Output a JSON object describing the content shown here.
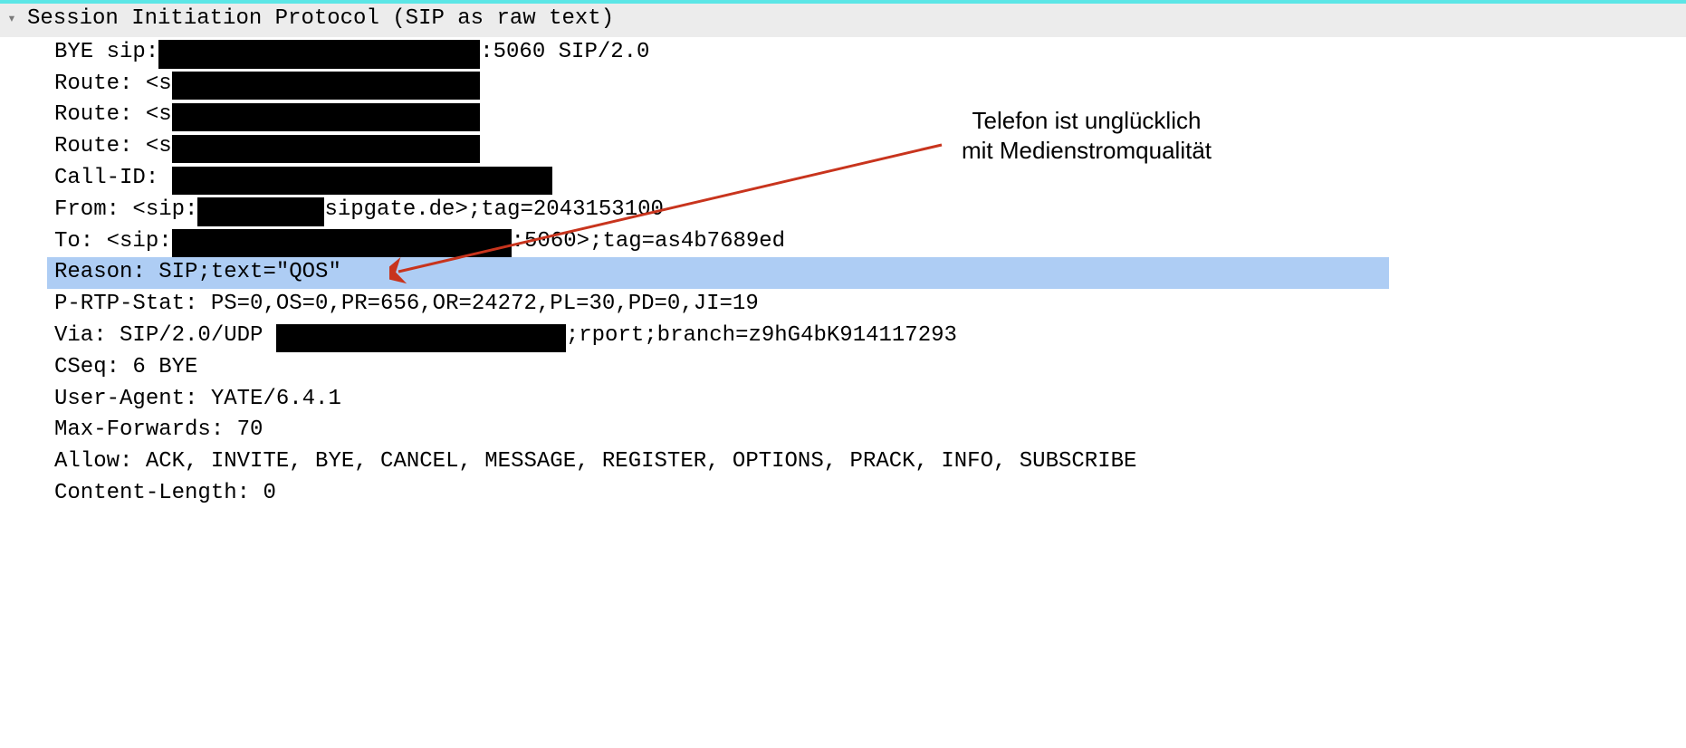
{
  "header": {
    "title": "Session Initiation Protocol (SIP as raw text)"
  },
  "sip": {
    "bye_before": "BYE sip:",
    "bye_after": ":5060 SIP/2.0",
    "route_prefix": "Route: <s",
    "callid_prefix": "Call-ID: ",
    "from_before": "From: <sip:",
    "from_after": "sipgate.de>;tag=2043153100",
    "to_before": "To: <sip:",
    "to_after": ":5060>;tag=as4b7689ed",
    "reason": "Reason: SIP;text=\"QOS\"",
    "prtp": "P-RTP-Stat: PS=0,OS=0,PR=656,OR=24272,PL=30,PD=0,JI=19",
    "via_before": "Via: SIP/2.0/UDP ",
    "via_after": ";rport;branch=z9hG4bK914117293",
    "cseq": "CSeq: 6 BYE",
    "ua": "User-Agent: YATE/6.4.1",
    "maxfwd": "Max-Forwards: 70",
    "allow": "Allow: ACK, INVITE, BYE, CANCEL, MESSAGE, REGISTER, OPTIONS, PRACK, INFO, SUBSCRIBE",
    "clen": "Content-Length: 0"
  },
  "annotation": {
    "line1": "Telefon ist unglücklich",
    "line2": "mit Medienstromqualität"
  },
  "redact_widths": {
    "bye": 355,
    "route1": 340,
    "route2": 340,
    "route3": 340,
    "callid": 420,
    "from": 140,
    "to": 375,
    "via": 320
  },
  "colors": {
    "highlight": "#aecdf4",
    "arrow": "#c8341d",
    "top_border": "#5ce6e6"
  }
}
